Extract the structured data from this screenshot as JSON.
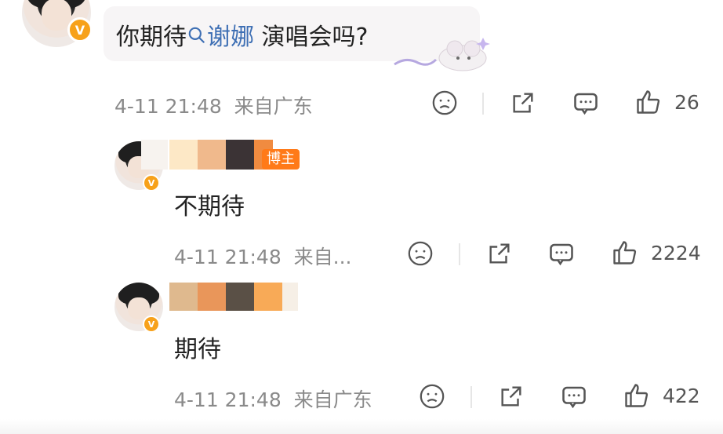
{
  "comment": {
    "text_prefix": "你期待",
    "topic": "谢娜",
    "text_suffix": " 演唱会吗?",
    "time": "4-11 21:48",
    "location": "来自广东",
    "likes": "26"
  },
  "replies": [
    {
      "author_tag": "博主",
      "text": "不期待",
      "time": "4-11 21:48",
      "location": "来自...",
      "likes": "2224",
      "swatches": [
        "#f7f3ef",
        "#fde8c6",
        "#f0b98c",
        "#3b3335",
        "#f08b40"
      ]
    },
    {
      "text": "期待",
      "time": "4-11 21:48",
      "location": "来自广东",
      "likes": "422",
      "swatches": [
        "#dfb98e",
        "#e9965a",
        "#5a5046",
        "#7d7360",
        "#f8aa57"
      ]
    }
  ],
  "colors": {
    "accent": "#3e6fb4",
    "badge": "#f7a11a",
    "tag": "#ff7a18"
  },
  "icons": [
    "sad-face-icon",
    "share-icon",
    "comment-icon",
    "thumbs-up-icon",
    "search-icon",
    "verified-badge-icon"
  ]
}
